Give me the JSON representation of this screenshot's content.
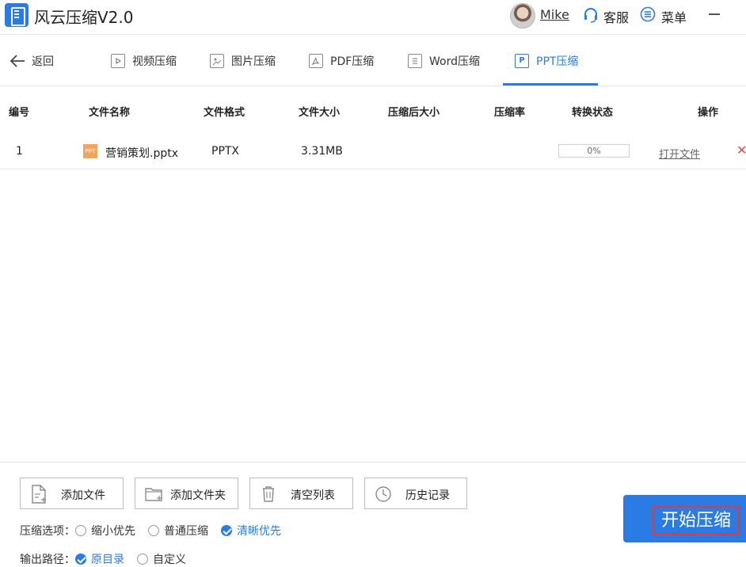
{
  "app": {
    "title": "风云压缩V2.0"
  },
  "user": {
    "name": "Mike"
  },
  "header": {
    "service_label": "客服",
    "menu_label": "菜单"
  },
  "nav": {
    "back_label": "返回",
    "tabs": [
      {
        "label": "视频压缩",
        "icon": "play-icon"
      },
      {
        "label": "图片压缩",
        "icon": "image-icon"
      },
      {
        "label": "PDF压缩",
        "icon": "pdf-icon"
      },
      {
        "label": "Word压缩",
        "icon": "word-icon"
      },
      {
        "label": "PPT压缩",
        "icon": "ppt-icon",
        "active": true
      }
    ]
  },
  "table": {
    "columns": [
      "编号",
      "文件名称",
      "文件格式",
      "文件大小",
      "压缩后大小",
      "压缩率",
      "转换状态",
      "操作"
    ],
    "rows": [
      {
        "index": "1",
        "name": "营销策划.pptx",
        "format": "PPTX",
        "size": "3.31MB",
        "compressed_size": "",
        "ratio": "",
        "progress_text": "0%",
        "progress": 0,
        "action": "打开文件"
      }
    ]
  },
  "toolbar": {
    "add_file": "添加文件",
    "add_folder": "添加文件夹",
    "clear_list": "清空列表",
    "history": "历史记录"
  },
  "options": {
    "compress_label": "压缩选项：",
    "compress_choices": [
      "缩小优先",
      "普通压缩",
      "清晰优先"
    ],
    "compress_selected": "清晰优先",
    "output_label": "输出路径：",
    "output_choices": [
      "原目录",
      "自定义"
    ],
    "output_selected": "原目录"
  },
  "start_button": {
    "label": "开始压缩"
  },
  "colors": {
    "accent": "#2a7be4",
    "danger": "#e84848",
    "ppt_icon": "#f4a55a"
  }
}
